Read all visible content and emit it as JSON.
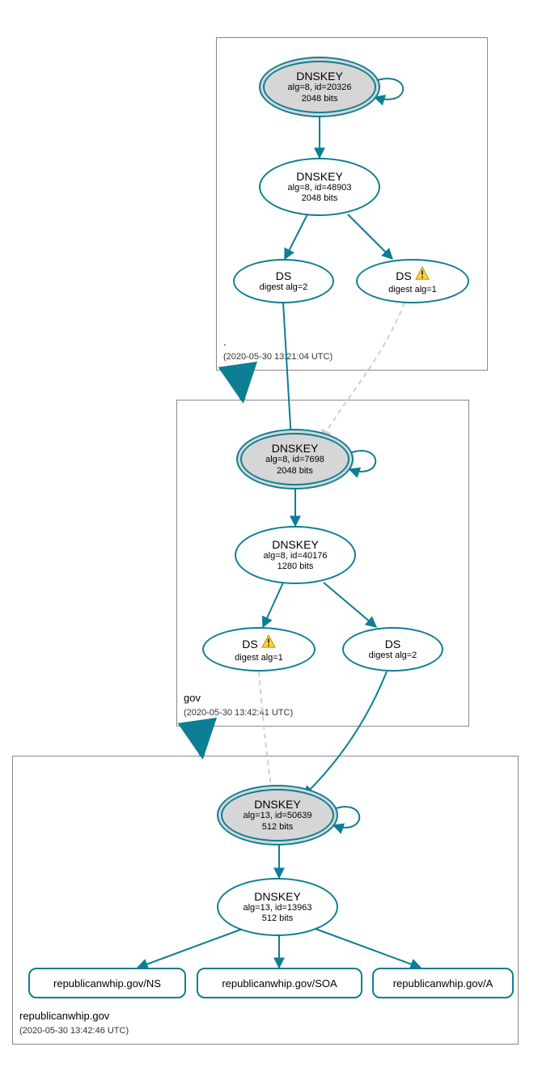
{
  "colors": {
    "stroke": "#0d7e94",
    "faded": "#cfcfcf",
    "box": "#888888",
    "ksk_fill": "#d6d6d6"
  },
  "zones": {
    "root": {
      "name": ".",
      "timestamp": "(2020-05-30 13:21:04 UTC)"
    },
    "gov": {
      "name": "gov",
      "timestamp": "(2020-05-30 13:42:41 UTC)"
    },
    "domain": {
      "name": "republicanwhip.gov",
      "timestamp": "(2020-05-30 13:42:46 UTC)"
    }
  },
  "nodes": {
    "root_ksk": {
      "title": "DNSKEY",
      "line1": "alg=8, id=20326",
      "line2": "2048 bits"
    },
    "root_zsk": {
      "title": "DNSKEY",
      "line1": "alg=8, id=48903",
      "line2": "2048 bits"
    },
    "root_ds2": {
      "title": "DS",
      "line1": "digest alg=2"
    },
    "root_ds1": {
      "title": "DS",
      "line1": "digest alg=1",
      "warn": true
    },
    "gov_ksk": {
      "title": "DNSKEY",
      "line1": "alg=8, id=7698",
      "line2": "2048 bits"
    },
    "gov_zsk": {
      "title": "DNSKEY",
      "line1": "alg=8, id=40176",
      "line2": "1280 bits"
    },
    "gov_ds1": {
      "title": "DS",
      "line1": "digest alg=1",
      "warn": true
    },
    "gov_ds2": {
      "title": "DS",
      "line1": "digest alg=2"
    },
    "dom_ksk": {
      "title": "DNSKEY",
      "line1": "alg=13, id=50639",
      "line2": "512 bits"
    },
    "dom_zsk": {
      "title": "DNSKEY",
      "line1": "alg=13, id=13963",
      "line2": "512 bits"
    },
    "rr_ns": {
      "label": "republicanwhip.gov/NS"
    },
    "rr_soa": {
      "label": "republicanwhip.gov/SOA"
    },
    "rr_a": {
      "label": "republicanwhip.gov/A"
    }
  }
}
